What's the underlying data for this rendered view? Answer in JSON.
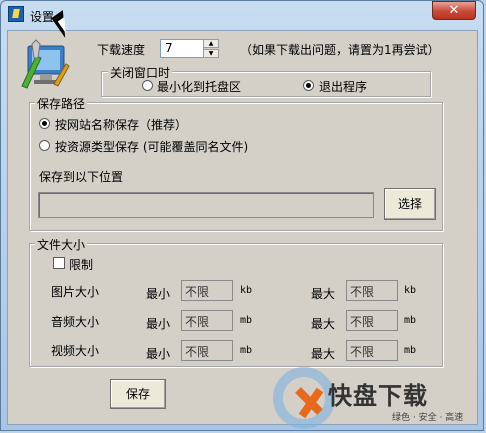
{
  "window": {
    "title": "设置",
    "close_symbol": "✕"
  },
  "download_speed": {
    "label": "下载速度",
    "value": "7",
    "hint": "（如果下载出问题，请置为1再尝试）"
  },
  "on_close": {
    "group_title": "关闭窗口时",
    "options": [
      "最小化到托盘区",
      "退出程序"
    ],
    "selected": "退出程序"
  },
  "save_path": {
    "group_title": "保存路径",
    "options": [
      "按网站名称保存（推荐）",
      "按资源类型保存 (可能覆盖同名文件)"
    ],
    "selected": "按网站名称保存（推荐）",
    "location_label": "保存到以下位置",
    "path_value": "",
    "choose_button": "选择"
  },
  "file_size": {
    "group_title": "文件大小",
    "limit_label": "限制",
    "min_label": "最小",
    "max_label": "最大",
    "rows": [
      {
        "label": "图片大小",
        "min": "不限",
        "min_unit": "kb",
        "max": "不限",
        "max_unit": "kb"
      },
      {
        "label": "音频大小",
        "min": "不限",
        "min_unit": "mb",
        "max": "不限",
        "max_unit": "mb"
      },
      {
        "label": "视频大小",
        "min": "不限",
        "min_unit": "mb",
        "max": "不限",
        "max_unit": "mb"
      }
    ]
  },
  "save_button": "保存",
  "watermark": {
    "brand": "快盘下载",
    "slogan": "绿色 · 安全 · 高速"
  },
  "colors": {
    "title_bar": "#bcd3ec",
    "dialog_bg": "#d4d0c8",
    "close_button": "#c8493a",
    "watermark_orange": "#e8691b"
  }
}
